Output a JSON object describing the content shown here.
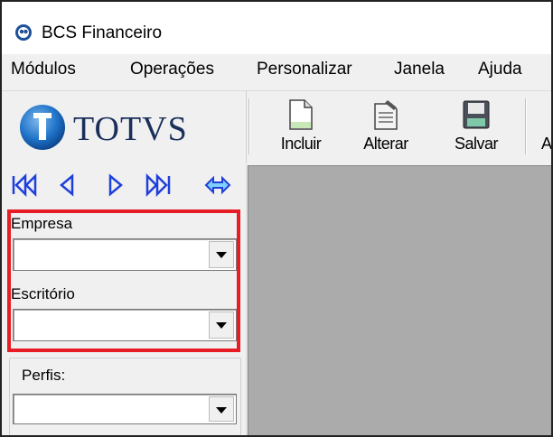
{
  "window": {
    "title": "BCS Financeiro"
  },
  "menu": [
    "Módulos",
    "Operações",
    "Personalizar",
    "Janela",
    "Ajuda"
  ],
  "logo": {
    "text": "TOTVS"
  },
  "toolbar": {
    "buttons": [
      {
        "label": "Incluir",
        "icon": "new-document-icon"
      },
      {
        "label": "Alterar",
        "icon": "edit-document-icon"
      },
      {
        "label": "Salvar",
        "icon": "save-disk-icon"
      },
      {
        "label": "A",
        "icon": "partial-button"
      }
    ]
  },
  "navigation": [
    "first-record-icon",
    "previous-record-icon",
    "next-record-icon",
    "last-record-icon",
    "swap-icon"
  ],
  "fields": {
    "empresa": {
      "label": "Empresa",
      "value": ""
    },
    "escritorio": {
      "label": "Escritório",
      "value": ""
    },
    "perfis": {
      "label": "Perfis:",
      "value": ""
    }
  },
  "colors": {
    "highlight": "#e81c24",
    "nav_blue": "#1f3fdc",
    "workspace": "#ababab",
    "logo_blue": "#1e73c8"
  }
}
